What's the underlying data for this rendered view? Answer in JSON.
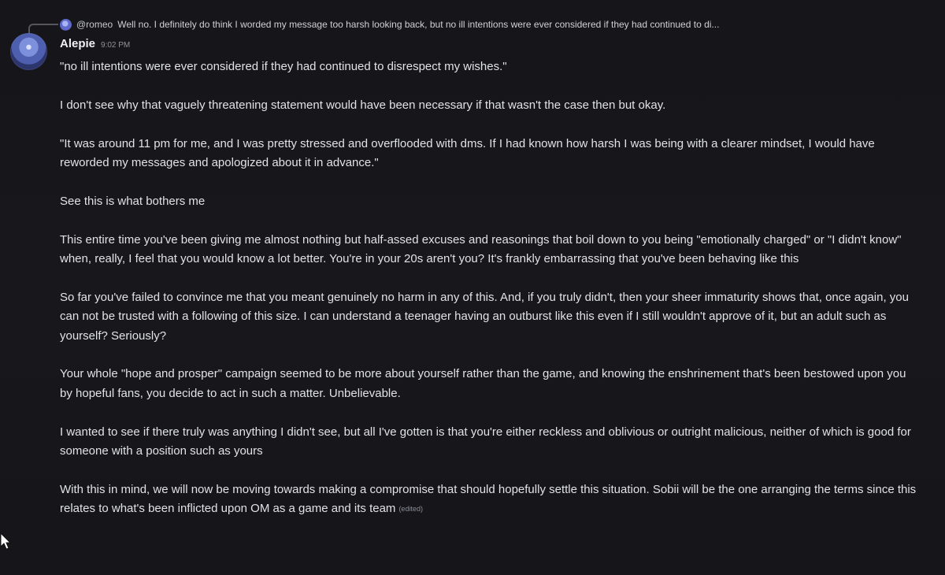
{
  "reply": {
    "author": "@romeo",
    "preview": "Well no. I definitely do think I worded my message too harsh looking back, but no ill intentions were ever considered if they had continued to di..."
  },
  "message": {
    "author": "Alepie",
    "timestamp": "9:02 PM",
    "edited_label": "(edited)",
    "paragraphs": [
      "\"no ill intentions were ever considered if they had continued to disrespect my wishes.\"",
      "I don't see why that vaguely threatening statement would have been necessary if that wasn't the case then but okay.",
      "\"It was around 11 pm for me, and I was pretty stressed and overflooded with dms. If I had known how harsh I was being with a clearer mindset, I would have reworded my messages and apologized about it in advance.\"",
      "See this is what bothers me",
      "This entire time you've been giving me almost nothing but half-assed excuses and reasonings that boil down to you being \"emotionally charged\" or \"I didn't know\" when, really, I feel that you would know a lot better. You're in your 20s aren't you? It's frankly embarrassing that you've been behaving like this",
      "So far you've failed to convince me that you meant genuinely no harm in any of this. And, if you truly didn't, then your sheer immaturity shows that, once again, you can not be trusted with a following of this size. I can understand a teenager having an outburst like this even if I still wouldn't approve of it, but an adult such as yourself? Seriously?",
      "Your whole \"hope and prosper\" campaign seemed to be more about yourself rather than the game, and knowing the enshrinement that's been bestowed upon you by hopeful fans, you decide to act in such a matter. Unbelievable.",
      "I wanted to see if there truly was anything I didn't see, but all I've gotten is that you're either reckless and oblivious or outright malicious, neither of which is good for someone with a position such as yours",
      "With this in mind, we will now be moving towards making a compromise that should hopefully settle this situation. Sobii will be the one arranging the terms since this relates to what's been inflicted upon OM as a game and its team"
    ]
  },
  "icons": {
    "reply_avatar": "user-avatar-icon",
    "author_avatar": "user-avatar-icon",
    "cursor": "mouse-pointer-icon"
  },
  "colors": {
    "background": "#17171b",
    "text": "#e1e2e5",
    "author": "#f0f1f4",
    "muted": "#8f9198"
  }
}
